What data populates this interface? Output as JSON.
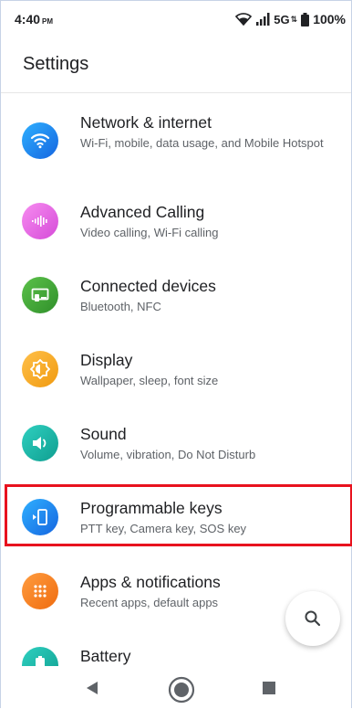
{
  "status_bar": {
    "time": "4:40",
    "am_pm": "PM",
    "network": "5G",
    "battery": "100%"
  },
  "header": {
    "title": "Settings"
  },
  "settings_items": [
    {
      "title": "Network & internet",
      "subtitle": "Wi-Fi, mobile, data usage, and Mobile Hotspot",
      "icon": "wifi-icon",
      "color": "#1a8cf0"
    },
    {
      "title": "Advanced Calling",
      "subtitle": "Video calling, Wi-Fi calling",
      "icon": "call-waves-icon",
      "color": "#e86fe8"
    },
    {
      "title": "Connected devices",
      "subtitle": "Bluetooth, NFC",
      "icon": "devices-icon",
      "color": "#43a839"
    },
    {
      "title": "Display",
      "subtitle": "Wallpaper, sleep, font size",
      "icon": "brightness-icon",
      "color": "#f5a623"
    },
    {
      "title": "Sound",
      "subtitle": "Volume, vibration, Do Not Disturb",
      "icon": "volume-icon",
      "color": "#17b5a8"
    },
    {
      "title": "Programmable keys",
      "subtitle": "PTT key, Camera key, SOS key",
      "icon": "key-phone-icon",
      "color": "#1a8cf0"
    },
    {
      "title": "Apps & notifications",
      "subtitle": "Recent apps, default apps",
      "icon": "apps-grid-icon",
      "color": "#f57c1f"
    },
    {
      "title": "Battery",
      "subtitle": "",
      "icon": "battery-icon",
      "color": "#17b5a8"
    }
  ],
  "highlight_color": "#e8121e",
  "navigation": {
    "back": "back-icon",
    "home": "home-icon",
    "recents": "recents-icon"
  }
}
